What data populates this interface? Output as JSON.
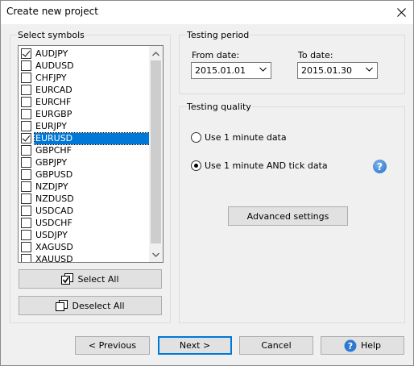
{
  "window": {
    "title": "Create new project"
  },
  "symbols": {
    "group_label": "Select symbols",
    "items": [
      {
        "label": "AUDJPY",
        "checked": true,
        "selected": false
      },
      {
        "label": "AUDUSD",
        "checked": false,
        "selected": false
      },
      {
        "label": "CHFJPY",
        "checked": false,
        "selected": false
      },
      {
        "label": "EURCAD",
        "checked": false,
        "selected": false
      },
      {
        "label": "EURCHF",
        "checked": false,
        "selected": false
      },
      {
        "label": "EURGBP",
        "checked": false,
        "selected": false
      },
      {
        "label": "EURJPY",
        "checked": false,
        "selected": false
      },
      {
        "label": "EURUSD",
        "checked": true,
        "selected": true
      },
      {
        "label": "GBPCHF",
        "checked": false,
        "selected": false
      },
      {
        "label": "GBPJPY",
        "checked": false,
        "selected": false
      },
      {
        "label": "GBPUSD",
        "checked": false,
        "selected": false
      },
      {
        "label": "NZDJPY",
        "checked": false,
        "selected": false
      },
      {
        "label": "NZDUSD",
        "checked": false,
        "selected": false
      },
      {
        "label": "USDCAD",
        "checked": false,
        "selected": false
      },
      {
        "label": "USDCHF",
        "checked": false,
        "selected": false
      },
      {
        "label": "USDJPY",
        "checked": false,
        "selected": false
      },
      {
        "label": "XAGUSD",
        "checked": false,
        "selected": false
      },
      {
        "label": "XAUUSD",
        "checked": false,
        "selected": false
      }
    ],
    "select_all_label": "Select All",
    "deselect_all_label": "Deselect All"
  },
  "testing_period": {
    "group_label": "Testing period",
    "from_label": "From date:",
    "from_value": "2015.01.01",
    "to_label": "To date:",
    "to_value": "2015.01.30"
  },
  "testing_quality": {
    "group_label": "Testing quality",
    "options": [
      {
        "label": "Use 1 minute data",
        "checked": false
      },
      {
        "label": "Use 1 minute AND tick data",
        "checked": true
      }
    ],
    "help_icon_glyph": "?",
    "advanced_label": "Advanced settings"
  },
  "footer": {
    "previous_label": "< Previous",
    "next_label": "Next >",
    "cancel_label": "Cancel",
    "help_label": "Help"
  },
  "colors": {
    "selection": "#0078d7",
    "dialog_bg": "#f0f0f0",
    "button_bg": "#e1e1e1"
  }
}
